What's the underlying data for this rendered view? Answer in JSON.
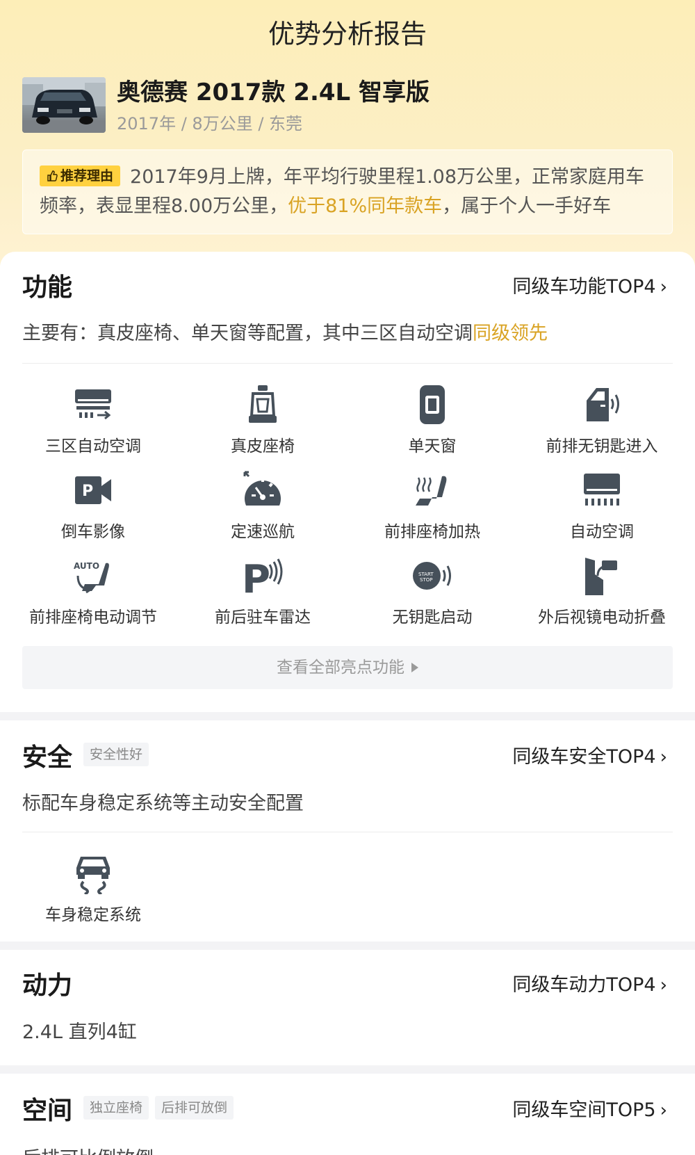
{
  "header": {
    "title": "优势分析报告"
  },
  "car": {
    "name": "奥德赛 2017款 2.4L 智享版",
    "meta": "2017年 / 8万公里 / 东莞"
  },
  "reason": {
    "tag": "推荐理由",
    "text_before": "2017年9月上牌，年平均行驶里程1.08万公里，正常家庭用车频率，表显里程8.00万公里，",
    "highlight": "优于81%同年款车",
    "text_after": "，属于个人一手好车"
  },
  "function": {
    "title": "功能",
    "link": "同级车功能TOP4",
    "desc_before": "主要有：真皮座椅、单天窗等配置，其中三区自动空调",
    "desc_highlight": "同级领先",
    "features": [
      {
        "label": "三区自动空调",
        "icon": "tri-zone-ac-icon"
      },
      {
        "label": "真皮座椅",
        "icon": "leather-seat-icon"
      },
      {
        "label": "单天窗",
        "icon": "sunroof-icon"
      },
      {
        "label": "前排无钥匙进入",
        "icon": "keyless-entry-icon"
      },
      {
        "label": "倒车影像",
        "icon": "rear-camera-icon"
      },
      {
        "label": "定速巡航",
        "icon": "cruise-control-icon"
      },
      {
        "label": "前排座椅加热",
        "icon": "seat-heating-icon"
      },
      {
        "label": "自动空调",
        "icon": "auto-ac-icon"
      },
      {
        "label": "前排座椅电动调节",
        "icon": "power-seat-icon"
      },
      {
        "label": "前后驻车雷达",
        "icon": "parking-radar-icon"
      },
      {
        "label": "无钥匙启动",
        "icon": "keyless-start-icon"
      },
      {
        "label": "外后视镜电动折叠",
        "icon": "mirror-fold-icon"
      }
    ],
    "see_all": "查看全部亮点功能",
    "icon_text": {
      "p": "P",
      "auto": "AUTO",
      "start": "START",
      "stop": "STOP"
    }
  },
  "safety": {
    "title": "安全",
    "chip": "安全性好",
    "link": "同级车安全TOP4",
    "desc": "标配车身稳定系统等主动安全配置",
    "features": [
      {
        "label": "车身稳定系统",
        "icon": "stability-control-icon"
      }
    ]
  },
  "power": {
    "title": "动力",
    "link": "同级车动力TOP4",
    "desc": "2.4L 直列4缸"
  },
  "space": {
    "title": "空间",
    "chips": [
      "独立座椅",
      "后排可放倒"
    ],
    "link": "同级车空间TOP5",
    "desc": "后排可比例放倒"
  },
  "colors": {
    "accent_gold": "#d9a324",
    "tag_yellow": "#ffd13f",
    "icon_gray": "#46505a"
  }
}
